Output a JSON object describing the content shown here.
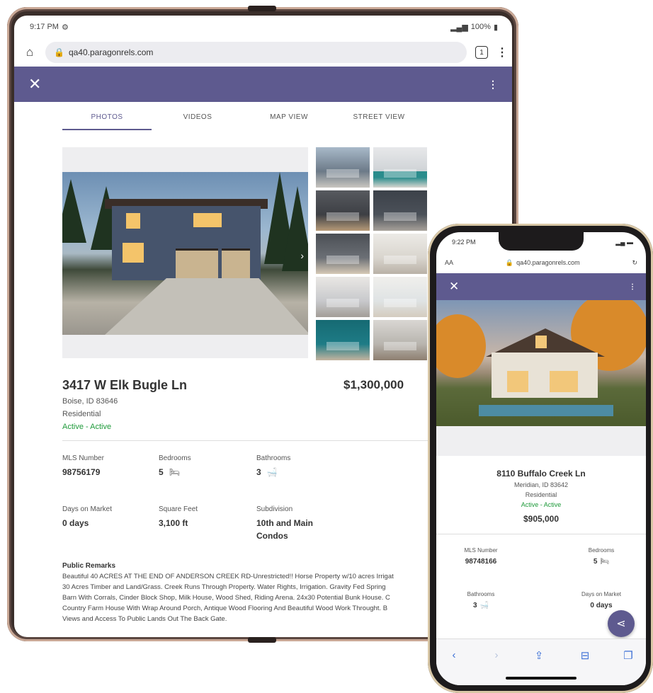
{
  "tablet": {
    "status": {
      "time": "9:17 PM",
      "battery": "100%"
    },
    "browser": {
      "url": "qa40.paragonrels.com",
      "tab_count": "1"
    },
    "appbar": {
      "close_glyph": "✕",
      "menu_glyph": "⋮"
    },
    "tabs": [
      {
        "label": "PHOTOS",
        "active": true
      },
      {
        "label": "VIDEOS",
        "active": false
      },
      {
        "label": "MAP VIEW",
        "active": false
      },
      {
        "label": "STREET VIEW",
        "active": false
      }
    ],
    "listing": {
      "address": "3417 W Elk Bugle Ln",
      "price": "$1,300,000",
      "city_state_zip": "Boise, ID 83646",
      "type": "Residential",
      "status": "Active - Active"
    },
    "facts": {
      "mls_label": "MLS Number",
      "mls_value": "98756179",
      "bed_label": "Bedrooms",
      "bed_value": "5",
      "bath_label": "Bathrooms",
      "bath_value": "3",
      "dom_label": "Days on Market",
      "dom_value": "0 days",
      "sqft_label": "Square Feet",
      "sqft_value": "3,100 ft",
      "subdiv_label": "Subdivision",
      "subdiv_line1": "10th and Main",
      "subdiv_line2": "Condos"
    },
    "remarks": {
      "heading": "Public Remarks",
      "lines": [
        "Beautiful 40 ACRES AT THE END OF ANDERSON CREEK RD-Unrestricted!! Horse Property w/10 acres Irrigat",
        "30 Acres Timber and Land/Grass. Creek Runs Through Property. Water Rights, Irrigation. Gravity Fed Spring",
        "Barn With Corrals, Cinder Block Shop, Milk House, Wood Shed, Riding Arena. 24x30 Potential Bunk House. C",
        "Country Farm House With Wrap Around Porch, Antique Wood Flooring And Beautiful Wood Work Throught. B",
        "Views and Access To Public Lands Out The Back Gate."
      ]
    }
  },
  "phone": {
    "status": {
      "time": "9:22 PM"
    },
    "browser": {
      "aa": "AA",
      "url": "qa40.paragonrels.com"
    },
    "listing": {
      "address": "8110 Buffalo Creek Ln",
      "city_state_zip": "Meridian, ID 83642",
      "type": "Residential",
      "status": "Active - Active",
      "price": "$905,000"
    },
    "facts": {
      "mls_label": "MLS Number",
      "mls_value": "98748166",
      "bed_label": "Bedrooms",
      "bed_value": "5",
      "bath_label": "Bathrooms",
      "bath_value": "3",
      "dom_label": "Days on Market",
      "dom_value": "0 days"
    }
  },
  "colors": {
    "accent": "#5e5a8f",
    "status_green": "#1e9a3a",
    "ios_blue": "#3b6fd6"
  }
}
